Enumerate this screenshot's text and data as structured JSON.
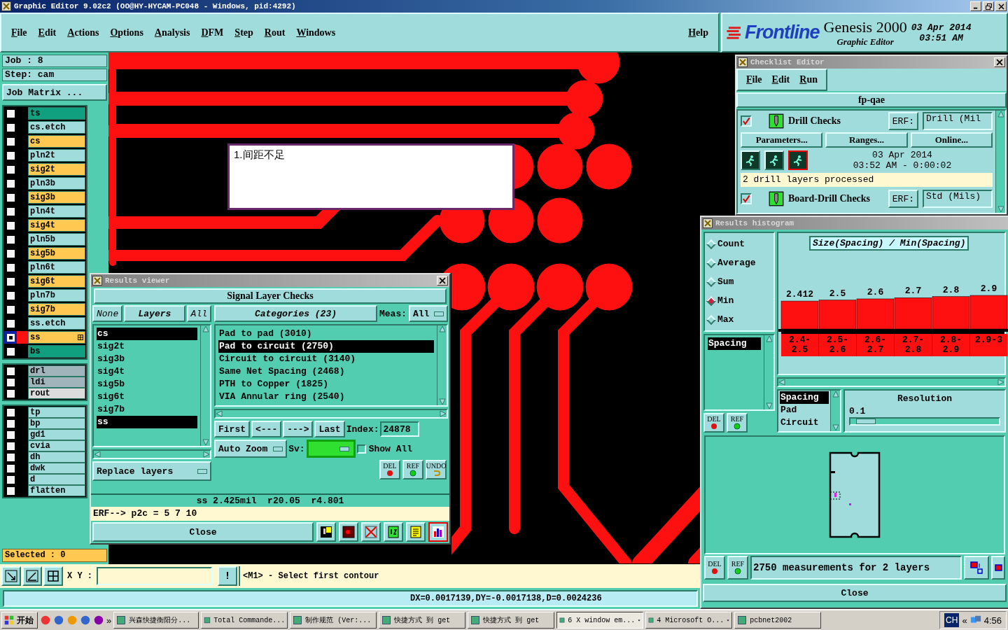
{
  "main_window": {
    "title": "Graphic Editor 9.02c2 (OO@HY-HYCAM-PC048 - Windows, pid:4292)"
  },
  "menu": [
    "File",
    "Edit",
    "Actions",
    "Options",
    "Analysis",
    "DFM",
    "Step",
    "Rout",
    "Windows"
  ],
  "help": "Help",
  "brand": {
    "logo": "Frontline",
    "product": "Genesis 2000",
    "subtitle": "Graphic Editor",
    "date": "03 Apr 2014",
    "time": "03:51 AM"
  },
  "job": {
    "job": "Job : 8",
    "step": "Step: cam",
    "matrix_button": "Job Matrix ..."
  },
  "layer_groups": [
    {
      "layers": [
        {
          "name": "ts",
          "color": "#10a080",
          "selected": false
        },
        {
          "name": "cs.etch",
          "color": "#a0dcdc",
          "selected": false
        },
        {
          "name": "cs",
          "color": "#ffc850",
          "selected": false
        },
        {
          "name": "pln2t",
          "color": "#a0dcdc",
          "selected": false
        },
        {
          "name": "sig2t",
          "color": "#ffc850",
          "selected": false
        },
        {
          "name": "pln3b",
          "color": "#a0dcdc",
          "selected": false
        },
        {
          "name": "sig3b",
          "color": "#ffc850",
          "selected": false
        },
        {
          "name": "pln4t",
          "color": "#a0dcdc",
          "selected": false
        },
        {
          "name": "sig4t",
          "color": "#ffc850",
          "selected": false
        },
        {
          "name": "pln5b",
          "color": "#a0dcdc",
          "selected": false
        },
        {
          "name": "sig5b",
          "color": "#ffc850",
          "selected": false
        },
        {
          "name": "pln6t",
          "color": "#a0dcdc",
          "selected": false
        },
        {
          "name": "sig6t",
          "color": "#ffc850",
          "selected": false
        },
        {
          "name": "pln7b",
          "color": "#a0dcdc",
          "selected": false
        },
        {
          "name": "sig7b",
          "color": "#ffc850",
          "selected": false
        },
        {
          "name": "ss.etch",
          "color": "#a0dcdc",
          "selected": false
        },
        {
          "name": "ss",
          "color": "#ffc850",
          "selected": true
        },
        {
          "name": "bs",
          "color": "#10a080",
          "selected": false
        }
      ]
    },
    {
      "layers": [
        {
          "name": "drl",
          "color": "#a0b4bc",
          "selected": false
        },
        {
          "name": "ldi",
          "color": "#a0b4bc",
          "selected": false
        },
        {
          "name": "rout",
          "color": "#dcdcdc",
          "selected": false
        }
      ]
    },
    {
      "layers": [
        {
          "name": "tp",
          "color": "#a0dcdc",
          "selected": false
        },
        {
          "name": "bp",
          "color": "#a0dcdc",
          "selected": false
        },
        {
          "name": "gd1",
          "color": "#a0dcdc",
          "selected": false
        },
        {
          "name": "cvia",
          "color": "#a0dcdc",
          "selected": false
        },
        {
          "name": "dh",
          "color": "#a0dcdc",
          "selected": false
        },
        {
          "name": "dwk",
          "color": "#a0dcdc",
          "selected": false
        },
        {
          "name": "d",
          "color": "#a0dcdc",
          "selected": false
        },
        {
          "name": "flatten",
          "color": "#a0dcdc",
          "selected": false
        }
      ]
    }
  ],
  "canvas": {
    "note": "1.间距不足"
  },
  "selected_count": "Selected : 0",
  "xy_label": "X Y :",
  "prompt_button": "!",
  "prompt": "<M1> - Select first contour",
  "measure": "DX=0.0017139,DY=-0.0017138,D=0.0024236",
  "results_viewer": {
    "title": "Results viewer",
    "header": "Signal Layer Checks",
    "layer_buttons": [
      "None",
      "Layers",
      "All"
    ],
    "layers": [
      {
        "name": "cs",
        "selected": true
      },
      {
        "name": "sig2t",
        "selected": false
      },
      {
        "name": "sig3b",
        "selected": false
      },
      {
        "name": "sig4t",
        "selected": false
      },
      {
        "name": "sig5b",
        "selected": false
      },
      {
        "name": "sig6t",
        "selected": false
      },
      {
        "name": "sig7b",
        "selected": false
      },
      {
        "name": "ss",
        "selected": true
      }
    ],
    "replace": "Replace layers",
    "categories_button": "Categories (23)",
    "meas_label": "Meas:",
    "meas_value": "All",
    "categories": [
      {
        "name": "Pad to pad (3010)",
        "selected": false
      },
      {
        "name": "Pad to circuit (2750)",
        "selected": true
      },
      {
        "name": "Circuit to circuit (3140)",
        "selected": false
      },
      {
        "name": "Same Net Spacing (2468)",
        "selected": false
      },
      {
        "name": "PTH to Copper (1825)",
        "selected": false
      },
      {
        "name": "VIA Annular ring (2540)",
        "selected": false
      }
    ],
    "nav": [
      "First",
      "<---",
      "--->",
      "Last"
    ],
    "index_label": "Index:",
    "index_value": "24878",
    "zoom": "Auto Zoom",
    "sv_label": "Sv:",
    "show_all": {
      "label": "Show All",
      "checked": false
    },
    "icon_buttons": [
      {
        "label": "DEL",
        "kind": "delete"
      },
      {
        "label": "REF",
        "kind": "reference"
      },
      {
        "label": "UNDO",
        "kind": "undo"
      }
    ],
    "status": "ss 2.425mil  r20.05  r4.801",
    "erf": "ERF--> p2c = 5 7 10",
    "close": "Close"
  },
  "checklist_editor": {
    "title": "Checklist Editor",
    "menu": [
      "File",
      "Edit",
      "Run"
    ],
    "checklist_name": "fp-qae",
    "checks": [
      {
        "name": "Drill Checks",
        "checked": true,
        "erf_label": "ERF:",
        "erf_value": "Drill (Mil",
        "buttons": [
          "Parameters...",
          "Ranges...",
          "Online..."
        ],
        "date": "03 Apr 2014",
        "time": "03:52 AM - 0:00:02",
        "message": "2 drill layers processed"
      },
      {
        "name": "Board-Drill Checks",
        "checked": true,
        "erf_label": "ERF:",
        "erf_value": "Std (Mils)"
      }
    ]
  },
  "histogram": {
    "title": "Results histogram",
    "modes": [
      {
        "label": "Count",
        "selected": false
      },
      {
        "label": "Average",
        "selected": false
      },
      {
        "label": "Sum",
        "selected": false
      },
      {
        "label": "Min",
        "selected": true
      },
      {
        "label": "Max",
        "selected": false
      }
    ],
    "measures": [
      {
        "name": "Spacing",
        "selected": true
      }
    ],
    "chart_data": {
      "type": "bar",
      "title": "Size(Spacing) / Min(Spacing)",
      "categories": [
        "2.4-2.5",
        "2.5-2.6",
        "2.6-2.7",
        "2.7-2.8",
        "2.8-2.9",
        "2.9-3"
      ],
      "values": [
        2.412,
        2.5,
        2.6,
        2.7,
        2.8,
        2.9
      ],
      "data_labels": true
    },
    "sub_list": [
      {
        "name": "Spacing",
        "selected": true
      },
      {
        "name": "Pad",
        "selected": false
      },
      {
        "name": "Circuit",
        "selected": false
      }
    ],
    "resolution": {
      "label": "Resolution",
      "value": "0.1",
      "level": 0.04
    },
    "list_buttons": [
      {
        "label": "DEL",
        "kind": "delete"
      },
      {
        "label": "REF",
        "kind": "reference"
      }
    ],
    "icon_buttons": [
      {
        "label": "DEL",
        "kind": "delete"
      },
      {
        "label": "REF",
        "kind": "reference"
      }
    ],
    "message": "2750 measurements for 2 layers",
    "close": "Close"
  },
  "taskbar": {
    "start": "开始",
    "more": "»",
    "items": [
      {
        "label": "兴森快捷衡阳分...",
        "selected": false,
        "dropdown": false
      },
      {
        "label": "Total Commande...",
        "selected": false,
        "dropdown": false
      },
      {
        "label": "制作规范 (Ver:...",
        "selected": false,
        "dropdown": false
      },
      {
        "label": "快捷方式 到 get",
        "selected": false,
        "dropdown": false
      },
      {
        "label": "快捷方式 到 get",
        "selected": false,
        "dropdown": false
      },
      {
        "label": "6 X window em...",
        "selected": true,
        "dropdown": true
      },
      {
        "label": "4 Microsoft O...",
        "selected": false,
        "dropdown": true
      },
      {
        "label": "pcbnet2002",
        "selected": false,
        "dropdown": false
      }
    ],
    "language": "CH",
    "tray_toggle": "«",
    "clock": "4:56"
  }
}
